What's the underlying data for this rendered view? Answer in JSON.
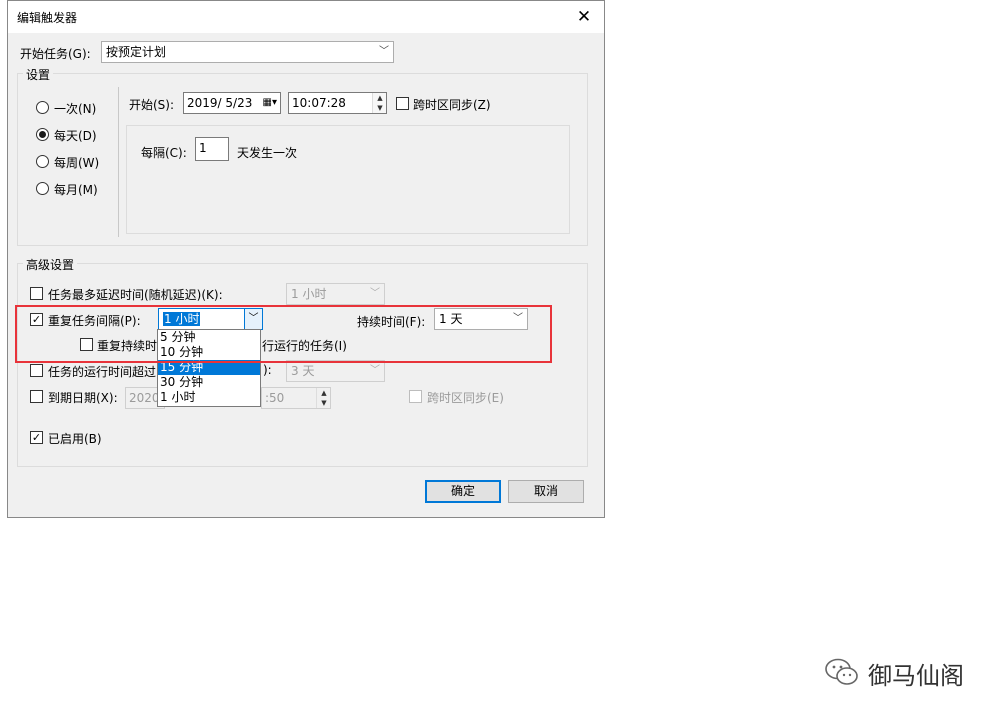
{
  "window": {
    "title": "编辑触发器",
    "close_glyph": "✕"
  },
  "begin_task": {
    "label": "开始任务(G):",
    "value": "按预定计划"
  },
  "settings": {
    "group_label": "设置",
    "radios": [
      {
        "label": "一次(N)",
        "checked": false
      },
      {
        "label": "每天(D)",
        "checked": true
      },
      {
        "label": "每周(W)",
        "checked": false
      },
      {
        "label": "每月(M)",
        "checked": false
      }
    ],
    "start_label": "开始(S):",
    "start_date": "2019/ 5/23",
    "start_time": "10:07:28",
    "sync_timezone_label": "跨时区同步(Z)",
    "recur_label": "每隔(C):",
    "recur_value": "1",
    "recur_suffix": "天发生一次"
  },
  "advanced": {
    "group_label": "高级设置",
    "delay": {
      "label": "任务最多延迟时间(随机延迟)(K):",
      "value": "1 小时",
      "checked": false
    },
    "repeat": {
      "label": "重复任务间隔(P):",
      "value": "1 小时",
      "checked": true,
      "duration_label": "持续时间(F):",
      "duration_value": "1 天",
      "stop_label_left": "重复持续时",
      "stop_label_right": "行运行的任务(I)",
      "stop_checked": false
    },
    "dropdown_options": [
      {
        "label": "5 分钟",
        "selected": false
      },
      {
        "label": "10 分钟",
        "selected": false
      },
      {
        "label": "15 分钟",
        "selected": true
      },
      {
        "label": "30 分钟",
        "selected": false
      },
      {
        "label": "1 小时",
        "selected": false
      }
    ],
    "stop_if_runs": {
      "label_left": "任务的运行时间超过",
      "label_right": "):",
      "value": "3 天",
      "checked": false
    },
    "expire": {
      "label": "到期日期(X):",
      "date": "2020/",
      "time": ":50",
      "sync_label": "跨时区同步(E)",
      "checked": false
    },
    "enabled": {
      "label": "已启用(B)",
      "checked": true
    }
  },
  "buttons": {
    "ok": "确定",
    "cancel": "取消"
  },
  "watermark": "御马仙阁",
  "colors": {
    "highlight_border": "#e8333a",
    "selection": "#0078d7"
  }
}
